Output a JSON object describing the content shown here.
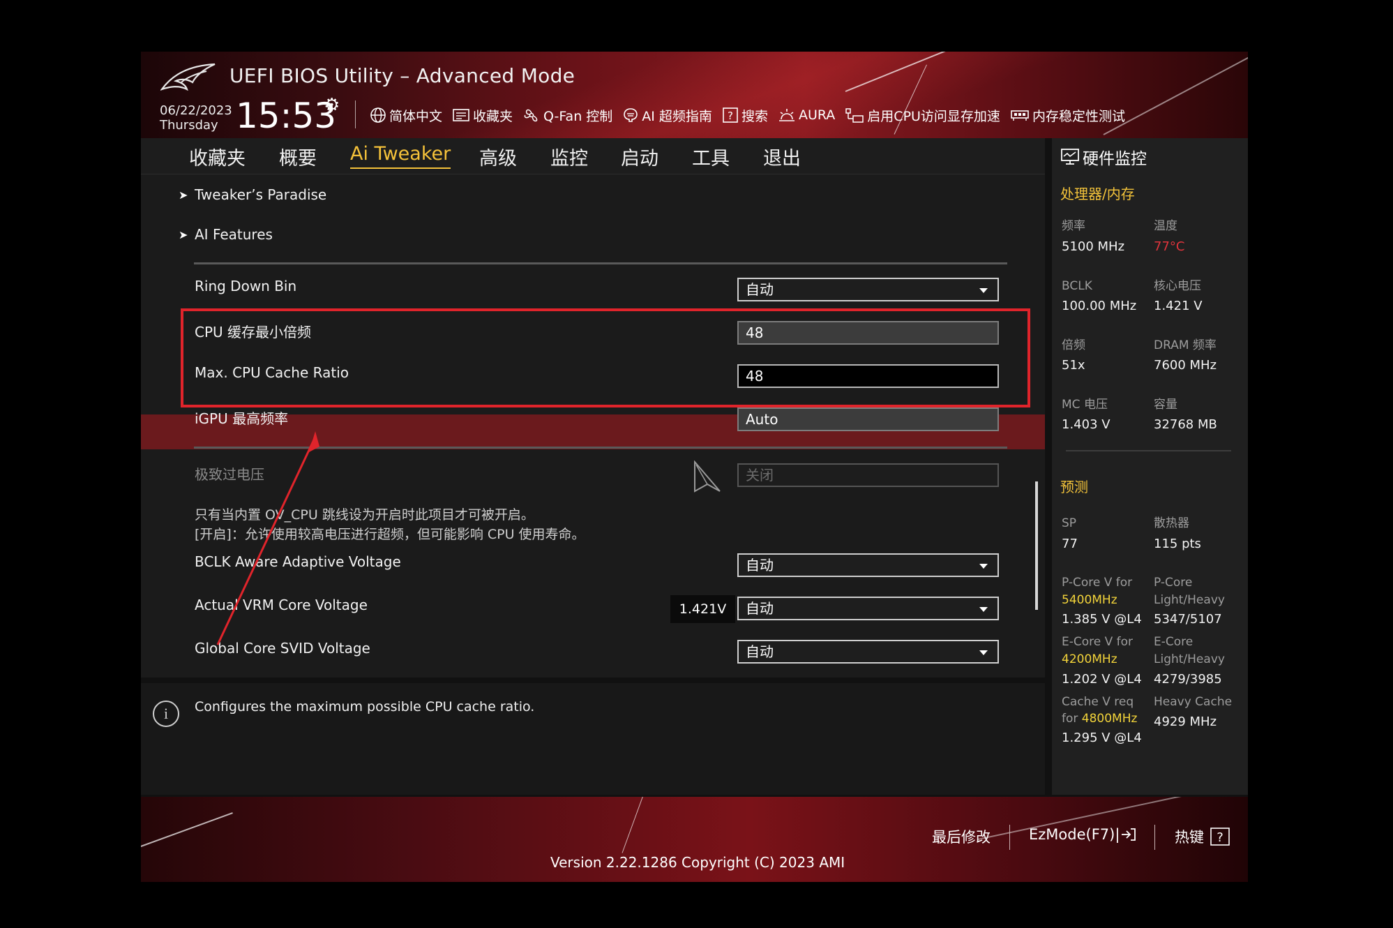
{
  "header": {
    "title": "UEFI BIOS Utility – Advanced Mode",
    "date": "06/22/2023",
    "day": "Thursday",
    "time": "15:53",
    "toolbar": [
      {
        "icon": "globe-icon",
        "label": "简体中文"
      },
      {
        "icon": "favorites-icon",
        "label": "收藏夹"
      },
      {
        "icon": "fan-icon",
        "label": "Q-Fan 控制"
      },
      {
        "icon": "ai-icon",
        "label": "AI 超频指南"
      },
      {
        "icon": "search-icon",
        "label": "搜索"
      },
      {
        "icon": "aura-icon",
        "label": "AURA"
      },
      {
        "icon": "resize-bar-icon",
        "label": "启用CPU访问显存加速"
      },
      {
        "icon": "memtest-icon",
        "label": "内存稳定性测试"
      }
    ]
  },
  "nav": {
    "tabs": [
      {
        "label": "收藏夹"
      },
      {
        "label": "概要"
      },
      {
        "label": "Ai Tweaker",
        "active": true
      },
      {
        "label": "高级"
      },
      {
        "label": "监控"
      },
      {
        "label": "启动"
      },
      {
        "label": "工具"
      },
      {
        "label": "退出"
      }
    ]
  },
  "settings": {
    "submenus": [
      "Tweaker’s Paradise",
      "AI Features"
    ],
    "ring_down_bin": {
      "label": "Ring Down Bin",
      "value": "自动"
    },
    "min_cache_ratio": {
      "label": "CPU 缓存最小倍频",
      "value": "48"
    },
    "max_cache_ratio": {
      "label": "Max. CPU Cache Ratio",
      "value": "48"
    },
    "igpu_max": {
      "label": "iGPU 最高频率",
      "value": "Auto"
    },
    "extreme_ov": {
      "label": "极致过电压",
      "value": "关闭"
    },
    "desc_line1": "只有当内置 OV_CPU 跳线设为开启时此项目才可被开启。",
    "desc_line2": "[开启]：允许使用较高电压进行超频，但可能影响 CPU 使用寿命。",
    "bclk_aware": {
      "label": "BCLK Aware Adaptive Voltage",
      "value": "自动"
    },
    "actual_vrm": {
      "label": "Actual VRM Core Voltage",
      "reading": "1.421V",
      "value": "自动"
    },
    "global_svid": {
      "label": "Global Core SVID Voltage",
      "value": "自动"
    }
  },
  "info": {
    "text": "Configures the maximum possible CPU cache ratio."
  },
  "monitor": {
    "title": "硬件监控",
    "section_cpu": "处理器/内存",
    "freq_label": "频率",
    "freq": "5100 MHz",
    "temp_label": "温度",
    "temp": "77°C",
    "bclk_label": "BCLK",
    "bclk": "100.00 MHz",
    "vcore_label": "核心电压",
    "vcore": "1.421 V",
    "ratio_label": "倍频",
    "ratio": "51x",
    "dram_label": "DRAM 频率",
    "dram": "7600 MHz",
    "mc_label": "MC 电压",
    "mc": "1.403 V",
    "cap_label": "容量",
    "cap": "32768 MB",
    "section_pred": "预测",
    "sp_label": "SP",
    "sp": "77",
    "cooler_label": "散热器",
    "cooler": "115 pts",
    "pcore_v_label": "P-Core V for",
    "pcore_v_freq": "5400MHz",
    "pcore_v": "1.385 V @L4",
    "pcore_lh_label1": "P-Core",
    "pcore_lh_label2": "Light/Heavy",
    "pcore_lh": "5347/5107",
    "ecore_v_label": "E-Core V for",
    "ecore_v_freq": "4200MHz",
    "ecore_v": "1.202 V @L4",
    "ecore_lh_label1": "E-Core",
    "ecore_lh_label2": "Light/Heavy",
    "ecore_lh": "4279/3985",
    "cache_v_label": "Cache V req",
    "cache_v_for": "for",
    "cache_v_freq": "4800MHz",
    "cache_v": "1.295 V @L4",
    "heavy_cache_label": "Heavy Cache",
    "heavy_cache": "4929 MHz"
  },
  "footer": {
    "last_modified": "最后修改",
    "ezmode": "EzMode(F7)|",
    "hotkeys": "热键",
    "version": "Version 2.22.1286 Copyright (C) 2023 AMI"
  },
  "colors": {
    "accent": "#f5c23a",
    "highlight_row": "#6b1a1d",
    "annotation": "#e0242b"
  }
}
